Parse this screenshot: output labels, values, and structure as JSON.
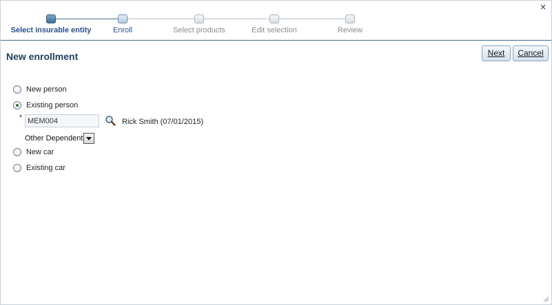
{
  "wizard": {
    "steps": [
      {
        "label": "Select insurable entity",
        "state": "current"
      },
      {
        "label": "Enroll",
        "state": "next"
      },
      {
        "label": "Select products",
        "state": "pending"
      },
      {
        "label": "Edit selection",
        "state": "pending"
      },
      {
        "label": "Review",
        "state": "pending"
      }
    ]
  },
  "window": {
    "close_glyph": "×"
  },
  "header": {
    "title": "New enrollment"
  },
  "buttons": {
    "next": "Next",
    "cancel": "Cancel"
  },
  "options": {
    "new_person": "New person",
    "existing_person": "Existing person",
    "new_car": "New car",
    "existing_car": "Existing car",
    "selected": "existing_person"
  },
  "member": {
    "required_mark": "*",
    "id_value": "MEM004",
    "name": "Rick Smith (07/01/2015)",
    "relation": "Other Dependent"
  },
  "icons": {
    "search": "search-icon",
    "dropdown": "chevron-down-icon",
    "close": "close-icon",
    "resize": "resize-grip-icon"
  },
  "colors": {
    "accent": "#2b4f8f",
    "title": "#1f3f5f",
    "separator": "#3b6a8a"
  }
}
